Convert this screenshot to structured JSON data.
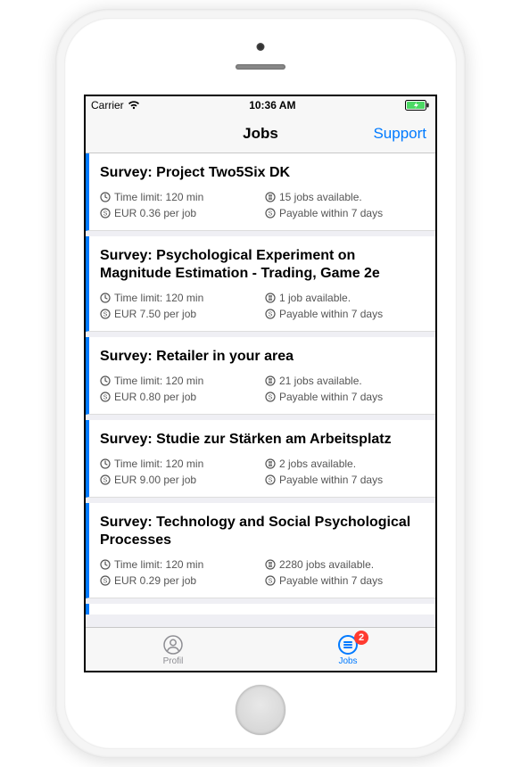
{
  "statusbar": {
    "carrier": "Carrier",
    "time": "10:36 AM"
  },
  "navbar": {
    "title": "Jobs",
    "right_action": "Support"
  },
  "jobs": [
    {
      "title": "Survey: Project Two5Six DK",
      "time_limit": "Time limit: 120 min",
      "availability": "15 jobs available.",
      "pay": "EUR 0.36 per job",
      "payable": "Payable within 7 days"
    },
    {
      "title": "Survey: Psychological Experiment on Magnitude Estimation - Trading, Game 2e",
      "time_limit": "Time limit: 120 min",
      "availability": "1 job available.",
      "pay": "EUR 7.50 per job",
      "payable": "Payable within 7 days"
    },
    {
      "title": "Survey: Retailer in your area",
      "time_limit": "Time limit: 120 min",
      "availability": "21 jobs available.",
      "pay": "EUR 0.80 per job",
      "payable": "Payable within 7 days"
    },
    {
      "title": "Survey: Studie zur Stärken am Arbeitsplatz",
      "time_limit": "Time limit: 120 min",
      "availability": "2 jobs available.",
      "pay": "EUR 9.00 per job",
      "payable": "Payable within 7 days"
    },
    {
      "title": "Survey: Technology and Social Psychological Processes",
      "time_limit": "Time limit: 120 min",
      "availability": "2280 jobs available.",
      "pay": "EUR 0.29 per job",
      "payable": "Payable within 7 days"
    }
  ],
  "tabbar": {
    "items": [
      {
        "label": "Profil",
        "active": false
      },
      {
        "label": "Jobs",
        "active": true,
        "badge": "2"
      }
    ]
  }
}
